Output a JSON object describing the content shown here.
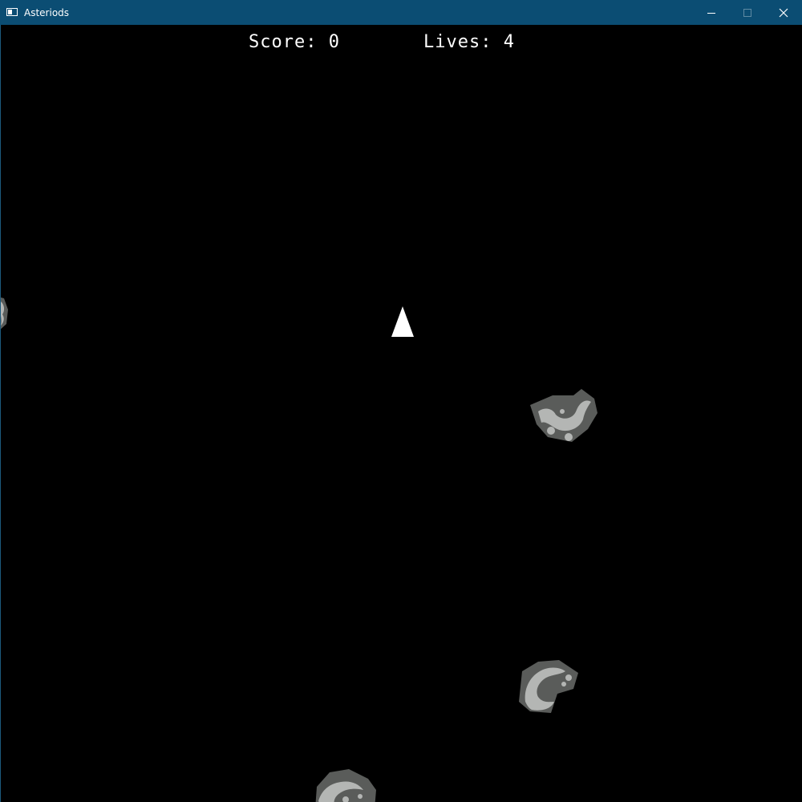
{
  "window": {
    "title": "Asteriods",
    "titlebar_color": "#0b4d73",
    "icon": "app-window-icon",
    "controls": {
      "minimize_icon": "minimize-icon",
      "maximize_icon": "maximize-icon",
      "close_icon": "close-icon"
    }
  },
  "hud": {
    "score_text": "Score: 0",
    "lives_text": "Lives: 4"
  },
  "game": {
    "background_color": "#000000",
    "ship_color": "#ffffff",
    "asteroid_colors": {
      "rock": "#5a5c5a",
      "highlight": "#b4b6b4"
    }
  }
}
